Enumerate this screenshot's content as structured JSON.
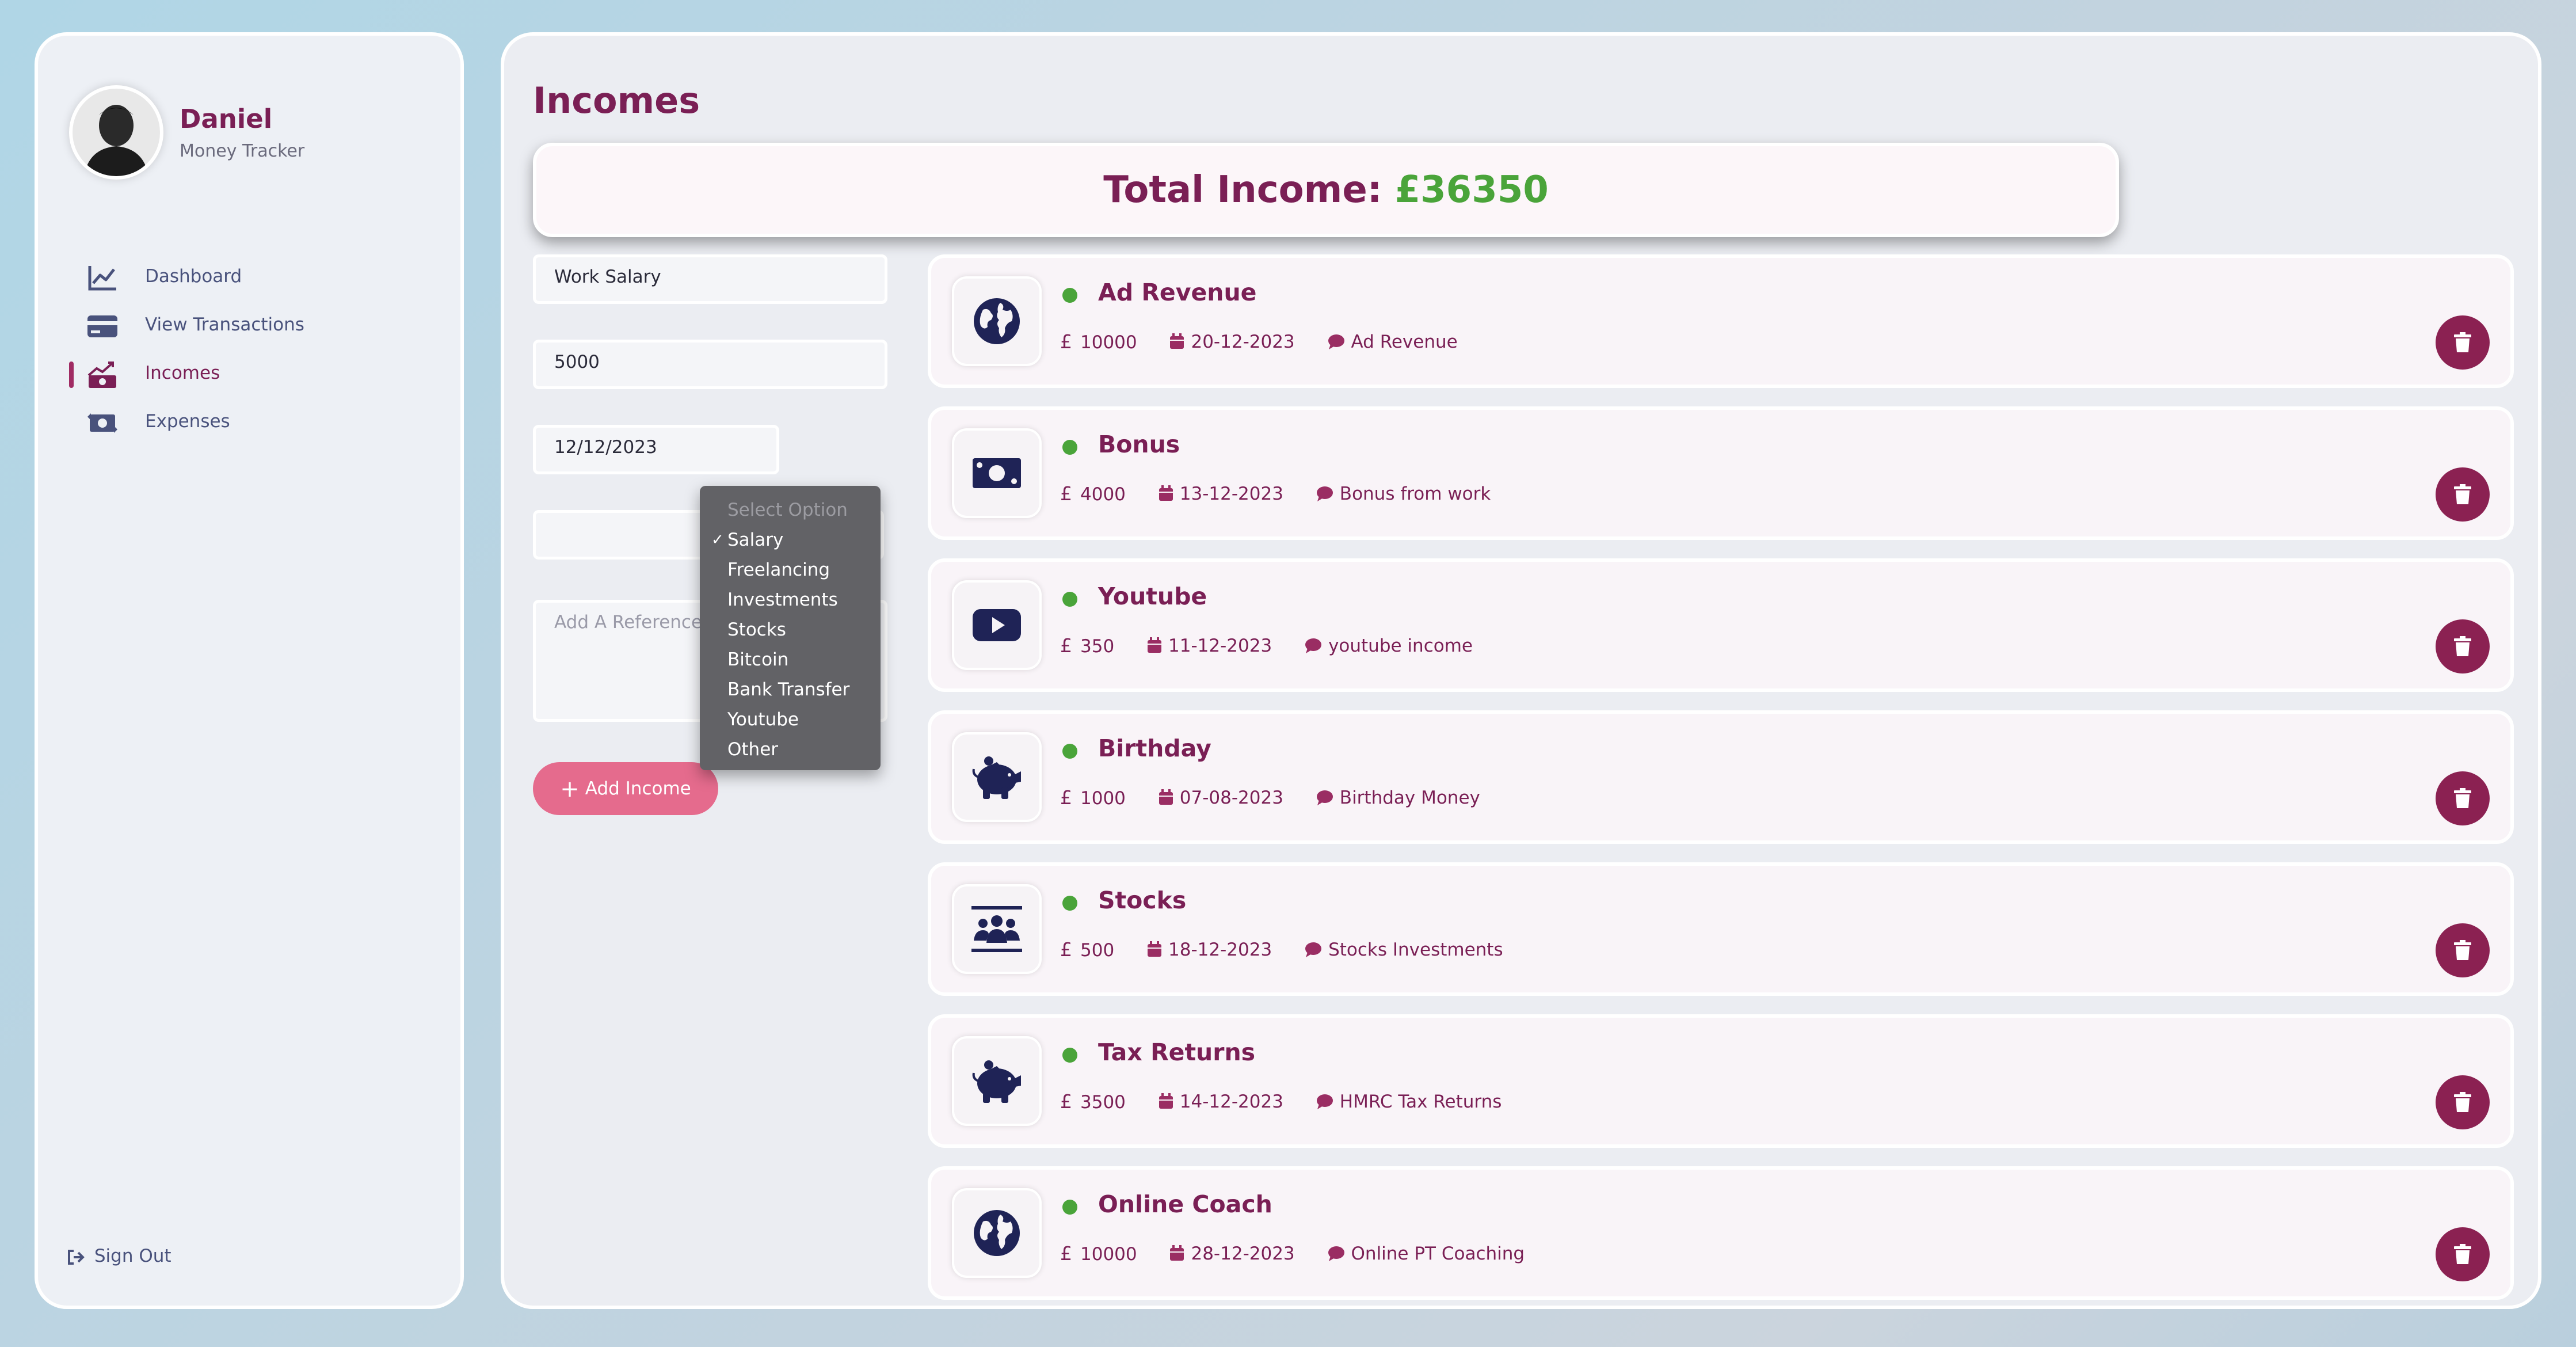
{
  "user": {
    "name": "Daniel",
    "role": "Money Tracker"
  },
  "nav": {
    "items": [
      {
        "label": "Dashboard",
        "icon": "chart-line-icon",
        "active": false
      },
      {
        "label": "View Transactions",
        "icon": "credit-card-icon",
        "active": false
      },
      {
        "label": "Incomes",
        "icon": "money-trend-icon",
        "active": true
      },
      {
        "label": "Expenses",
        "icon": "money-exchange-icon",
        "active": false
      }
    ],
    "sign_out": "Sign Out"
  },
  "page": {
    "title": "Incomes",
    "total_label": "Total Income:",
    "total_value": "£36350"
  },
  "form": {
    "title_value": "Work Salary",
    "amount_value": "5000",
    "date_value": "12/12/2023",
    "reference_placeholder": "Add A Reference",
    "submit_label": "Add Income"
  },
  "category_dropdown": {
    "placeholder": "Select Option",
    "selected": "Salary",
    "options": [
      "Salary",
      "Freelancing",
      "Investments",
      "Stocks",
      "Bitcoin",
      "Bank Transfer",
      "Youtube",
      "Other"
    ]
  },
  "incomes": [
    {
      "title": "Ad Revenue",
      "amount": "10000",
      "date": "20-12-2023",
      "description": "Ad Revenue",
      "icon": "globe-icon"
    },
    {
      "title": "Bonus",
      "amount": "4000",
      "date": "13-12-2023",
      "description": "Bonus from work",
      "icon": "money-bill-icon"
    },
    {
      "title": "Youtube",
      "amount": "350",
      "date": "11-12-2023",
      "description": "youtube income",
      "icon": "youtube-icon"
    },
    {
      "title": "Birthday",
      "amount": "1000",
      "date": "07-08-2023",
      "description": "Birthday Money",
      "icon": "piggy-bank-icon"
    },
    {
      "title": "Stocks",
      "amount": "500",
      "date": "18-12-2023",
      "description": "Stocks Investments",
      "icon": "users-group-icon"
    },
    {
      "title": "Tax Returns",
      "amount": "3500",
      "date": "14-12-2023",
      "description": "HMRC Tax Returns",
      "icon": "piggy-bank-icon"
    },
    {
      "title": "Online Coach",
      "amount": "10000",
      "date": "28-12-2023",
      "description": "Online PT Coaching",
      "icon": "globe-icon"
    }
  ],
  "currency_symbol": "£",
  "colors": {
    "brand": "#7a1f55",
    "accent_button": "#e56b8d",
    "positive": "#4aa43a",
    "delete": "#8b2152",
    "icon_navy": "#1f2356"
  }
}
